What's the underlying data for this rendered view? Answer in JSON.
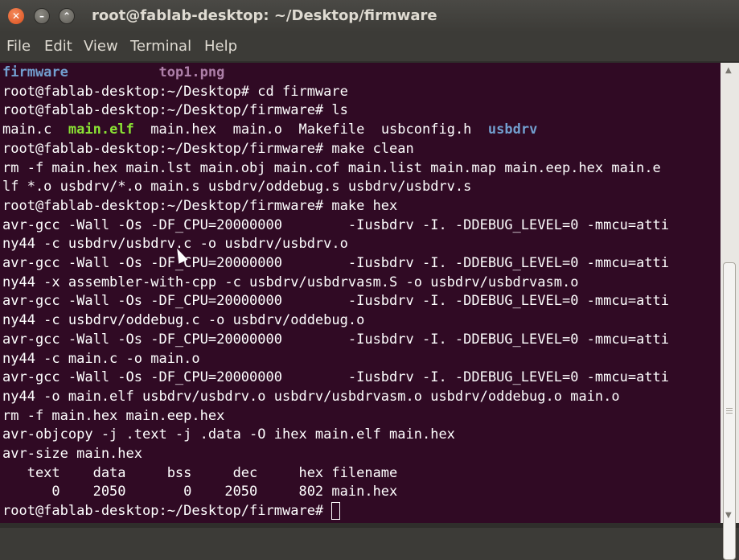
{
  "window": {
    "title": "root@fablab-desktop: ~/Desktop/firmware"
  },
  "menu": [
    "File",
    "Edit",
    "View",
    "Terminal",
    "Help"
  ],
  "terminal": {
    "lines": [
      [
        {
          "t": "firmware",
          "c": "blue"
        },
        {
          "t": "           "
        },
        {
          "t": "top1.png",
          "c": "pink"
        }
      ],
      [
        {
          "t": "root@fablab-desktop:~/Desktop# cd firmware"
        }
      ],
      [
        {
          "t": "root@fablab-desktop:~/Desktop/firmware# ls"
        }
      ],
      [
        {
          "t": "main.c  "
        },
        {
          "t": "main.elf",
          "c": "green"
        },
        {
          "t": "  main.hex  main.o  Makefile  usbconfig.h  "
        },
        {
          "t": "usbdrv",
          "c": "blue"
        }
      ],
      [
        {
          "t": "root@fablab-desktop:~/Desktop/firmware# make clean"
        }
      ],
      [
        {
          "t": "rm -f main.hex main.lst main.obj main.cof main.list main.map main.eep.hex main.e"
        }
      ],
      [
        {
          "t": "lf *.o usbdrv/*.o main.s usbdrv/oddebug.s usbdrv/usbdrv.s"
        }
      ],
      [
        {
          "t": "root@fablab-desktop:~/Desktop/firmware# make hex"
        }
      ],
      [
        {
          "t": "avr-gcc -Wall -Os -DF_CPU=20000000        -Iusbdrv -I. -DDEBUG_LEVEL=0 -mmcu=atti"
        }
      ],
      [
        {
          "t": "ny44 -c usbdrv/usbdrv.c -o usbdrv/usbdrv.o"
        }
      ],
      [
        {
          "t": "avr-gcc -Wall -Os -DF_CPU=20000000        -Iusbdrv -I. -DDEBUG_LEVEL=0 -mmcu=atti"
        }
      ],
      [
        {
          "t": "ny44 -x assembler-with-cpp -c usbdrv/usbdrvasm.S -o usbdrv/usbdrvasm.o"
        }
      ],
      [
        {
          "t": "avr-gcc -Wall -Os -DF_CPU=20000000        -Iusbdrv -I. -DDEBUG_LEVEL=0 -mmcu=atti"
        }
      ],
      [
        {
          "t": "ny44 -c usbdrv/oddebug.c -o usbdrv/oddebug.o"
        }
      ],
      [
        {
          "t": "avr-gcc -Wall -Os -DF_CPU=20000000        -Iusbdrv -I. -DDEBUG_LEVEL=0 -mmcu=atti"
        }
      ],
      [
        {
          "t": "ny44 -c main.c -o main.o"
        }
      ],
      [
        {
          "t": "avr-gcc -Wall -Os -DF_CPU=20000000        -Iusbdrv -I. -DDEBUG_LEVEL=0 -mmcu=atti"
        }
      ],
      [
        {
          "t": "ny44 -o main.elf usbdrv/usbdrv.o usbdrv/usbdrvasm.o usbdrv/oddebug.o main.o"
        }
      ],
      [
        {
          "t": "rm -f main.hex main.eep.hex"
        }
      ],
      [
        {
          "t": "avr-objcopy -j .text -j .data -O ihex main.elf main.hex"
        }
      ],
      [
        {
          "t": "avr-size main.hex"
        }
      ],
      [
        {
          "t": "   text    data     bss     dec     hex filename"
        }
      ],
      [
        {
          "t": "      0    2050       0    2050     802 main.hex"
        }
      ],
      [
        {
          "t": "root@fablab-desktop:~/Desktop/firmware# "
        }
      ]
    ]
  },
  "colors": {
    "background": "#300a24",
    "directory": "#729fcf",
    "image": "#ad7fa8",
    "executable": "#8ae234",
    "text": "#ffffff"
  }
}
